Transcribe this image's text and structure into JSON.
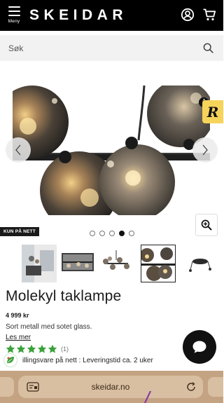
{
  "header": {
    "menu_label": "Meny",
    "logo": "SKEIDAR",
    "icons": [
      "menu-icon",
      "account-icon",
      "cart-icon"
    ]
  },
  "search": {
    "placeholder": "Søk",
    "icon": "search-icon"
  },
  "gallery": {
    "badge_online": "KUN PÅ NETT",
    "badge_r_letter": "R",
    "badge_r_info": "i",
    "slide_count": 5,
    "active_slide": 4,
    "thumbnail_count": 5,
    "active_thumbnail": 4
  },
  "product": {
    "title": "Molekyl taklampe",
    "price": "4 999 kr",
    "description": "Sort metall med sotet glass.",
    "read_more": "Les mer",
    "rating": 5,
    "rating_count": "(1)",
    "delivery": "illingsvare på nett : Leveringstid ca. 2 uker"
  },
  "browser": {
    "url": "skeidar.no"
  },
  "colors": {
    "header_bg": "#000000",
    "browser_bar": "#c4a383",
    "star": "#3aa23a",
    "badge_yellow": "#f6d35a"
  }
}
